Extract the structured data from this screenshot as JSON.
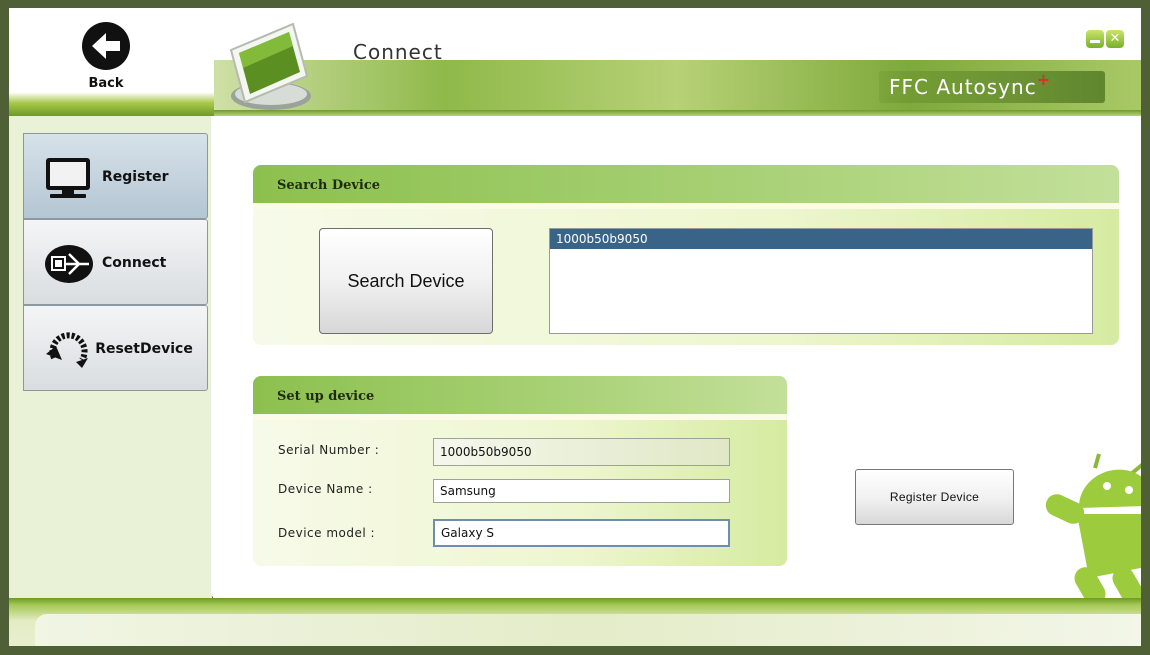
{
  "header": {
    "back_label": "Back",
    "title": "Connect",
    "brand": "FFC Autosync",
    "brand_mark": "+",
    "close_glyph": "✕"
  },
  "sidebar": {
    "items": [
      {
        "label": "Register",
        "icon": "monitor-icon",
        "active": true
      },
      {
        "label": "Connect",
        "icon": "plug-icon",
        "active": false
      },
      {
        "label_line1": "Reset",
        "label_line2": "Device",
        "icon": "reset-arrow-icon",
        "active": false
      }
    ]
  },
  "search_panel": {
    "title": "Search Device",
    "button_label": "Search Device",
    "devices": [
      "1000b50b9050"
    ],
    "selected_index": 0
  },
  "setup_panel": {
    "title": "Set up device",
    "fields": [
      {
        "label": "Serial Number :",
        "value": "1000b50b9050"
      },
      {
        "label": "Device Name :",
        "value": "Samsung"
      },
      {
        "label": "Device model :",
        "value": "Galaxy S"
      }
    ]
  },
  "register_button_label": "Register Device",
  "colors": {
    "frame": "#4f6036",
    "accent_green": "#8cc04e",
    "selection_blue": "#3a6487",
    "window_button_green": "#78b02a",
    "brand_plus_red": "#e22b2b"
  }
}
